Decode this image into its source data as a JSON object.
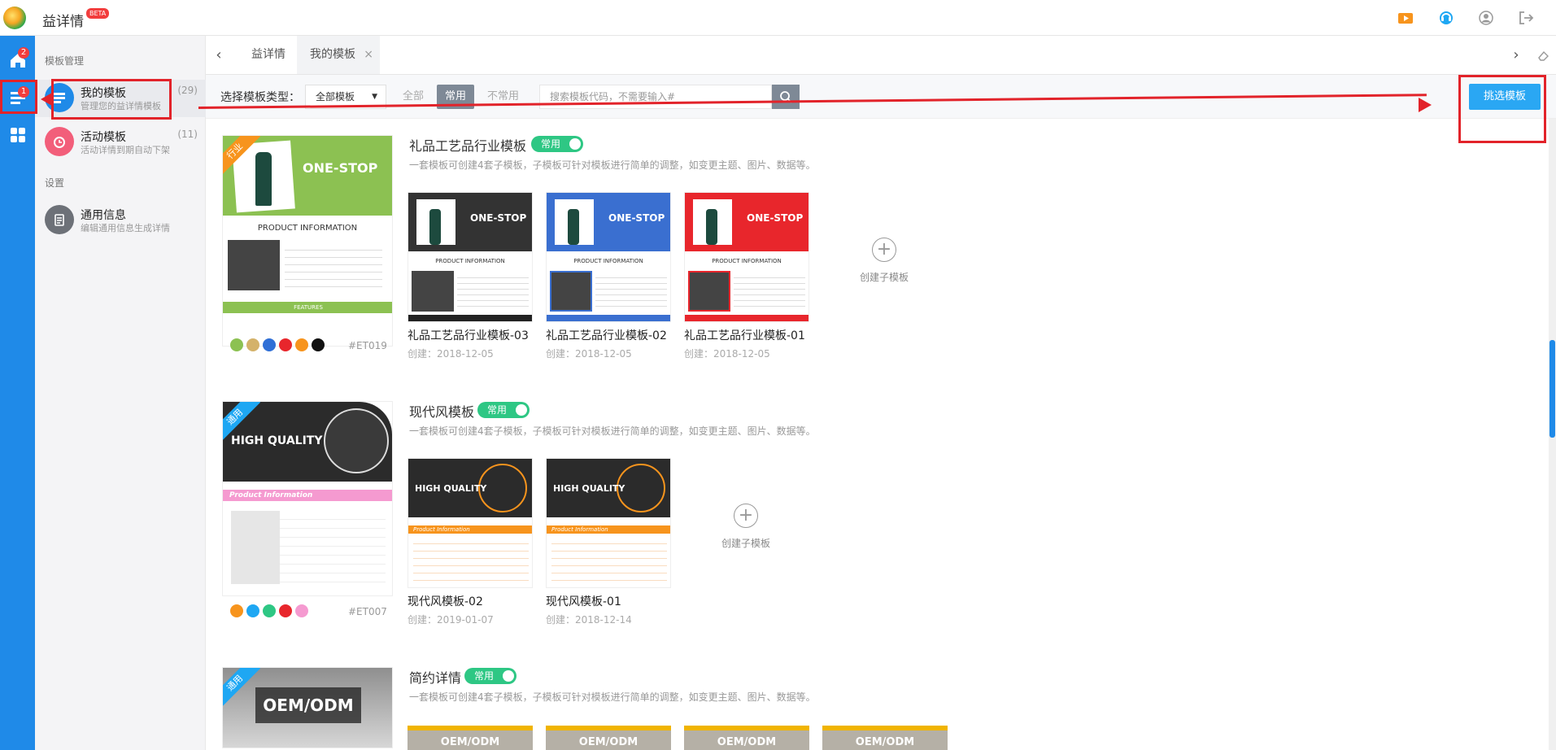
{
  "app": {
    "title": "益详情",
    "beta": "BETA"
  },
  "rail": {
    "home_badge": "2",
    "templates_badge": "1"
  },
  "side": {
    "section_templates": "模板管理",
    "my_templates": {
      "title": "我的模板",
      "subtitle": "管理您的益详情模板",
      "count": "(29)"
    },
    "activity_templates": {
      "title": "活动模板",
      "subtitle": "活动详情到期自动下架",
      "count": "(11)"
    },
    "section_settings": "设置",
    "general_info": {
      "title": "通用信息",
      "subtitle": "编辑通用信息生成详情"
    }
  },
  "tabs": [
    {
      "label": "益详情"
    },
    {
      "label": "我的模板",
      "close": "×"
    }
  ],
  "filter": {
    "label": "选择模板类型：",
    "select_value": "全部模板",
    "all": "全部",
    "common": "常用",
    "uncommon": "不常用",
    "search_placeholder": "搜索模板代码，不需要输入#",
    "pick_button": "挑选模板"
  },
  "sections": [
    {
      "ribbon": "行业",
      "title": "礼品工艺品行业模板",
      "toggle": "常用",
      "desc": "一套模板可创建4套子模板，子模板可针对模板进行简单的调整，如变更主题、图片、数据等。",
      "code": "#ET019",
      "swatches": [
        "#8cc152",
        "#d4b26a",
        "#2f6fd6",
        "#e8262c",
        "#f7941d",
        "#111111"
      ],
      "cover_banner": "ONE-STOP",
      "cover_heading": "PRODUCT INFORMATION",
      "cover_footer": "FEATURES",
      "cards": [
        {
          "name": "礼品工艺品行业模板-03",
          "date": "创建：2018-12-05",
          "color": "#333333",
          "banner": "ONE-STOP",
          "heading": "PRODUCT INFORMATION"
        },
        {
          "name": "礼品工艺品行业模板-02",
          "date": "创建：2018-12-05",
          "color": "#3a6fd0",
          "banner": "ONE-STOP",
          "heading": "PRODUCT INFORMATION"
        },
        {
          "name": "礼品工艺品行业模板-01",
          "date": "创建：2018-12-05",
          "color": "#e8262c",
          "banner": "ONE-STOP",
          "heading": "PRODUCT INFORMATION"
        }
      ],
      "create_label": "创建子模板"
    },
    {
      "ribbon": "通用",
      "title": "现代风模板",
      "toggle": "常用",
      "desc": "一套模板可创建4套子模板，子模板可针对模板进行简单的调整，如变更主题、图片、数据等。",
      "code": "#ET007",
      "swatches": [
        "#f7941d",
        "#1ea7f3",
        "#2ec784",
        "#e8262c",
        "#f59ad0"
      ],
      "cover_banner": "HIGH QUALITY",
      "cover_heading": "Product Information",
      "cards": [
        {
          "name": "现代风模板-02",
          "date": "创建：2019-01-07",
          "banner": "HIGH QUALITY",
          "heading": "Product Information"
        },
        {
          "name": "现代风模板-01",
          "date": "创建：2018-12-14",
          "banner": "HIGH QUALITY",
          "heading": "Product Information"
        }
      ],
      "create_label": "创建子模板"
    },
    {
      "ribbon": "通用",
      "title": "简约详情",
      "toggle": "常用",
      "desc": "一套模板可创建4套子模板，子模板可针对模板进行简单的调整，如变更主题、图片、数据等。",
      "cover_banner": "OEM/ODM",
      "cards_banner": "OEM/ODM"
    }
  ]
}
